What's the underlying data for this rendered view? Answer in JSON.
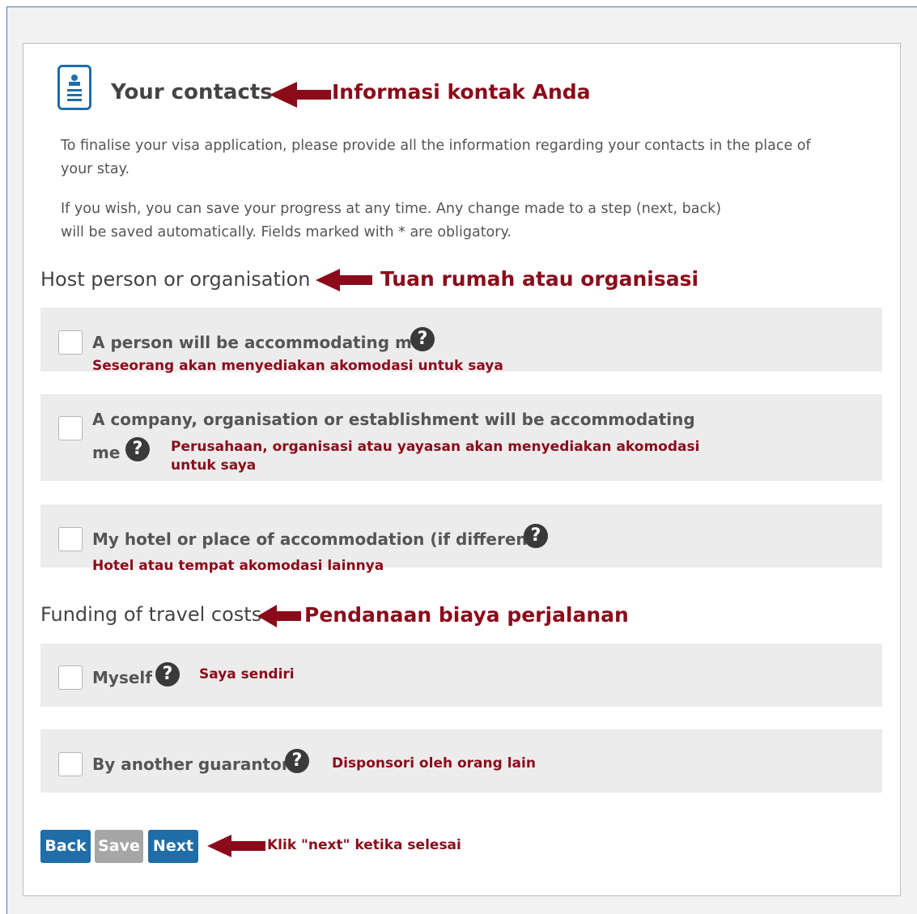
{
  "header": {
    "title": "Your contacts",
    "annotation": "Informasi kontak Anda"
  },
  "intro": {
    "line1": "To finalise your visa application, please provide all the information regarding your contacts in the place of",
    "line2": "your stay.",
    "line3": "If you wish, you can save your progress at any time. Any change made to a step (next, back)",
    "line4": "will be saved automatically. Fields marked with * are obligatory."
  },
  "host_section": {
    "heading": "Host person or organisation",
    "annotation": "Tuan rumah atau organisasi",
    "options": [
      {
        "label": "A person will be accommodating me",
        "annotation": "Seseorang akan menyediakan akomodasi untuk saya",
        "checked": false
      },
      {
        "label_line1": "A company, organisation or establishment will be accommodating",
        "label_line2": "me",
        "annotation_line1": "Perusahaan, organisasi atau yayasan akan menyediakan akomodasi",
        "annotation_line2": "untuk saya",
        "checked": false
      },
      {
        "label": "My hotel or place of accommodation (if different)",
        "annotation": "Hotel atau tempat akomodasi lainnya",
        "checked": false
      }
    ]
  },
  "funding_section": {
    "heading": "Funding of travel costs",
    "annotation": "Pendanaan biaya perjalanan",
    "options": [
      {
        "label": "Myself",
        "annotation": "Saya sendiri",
        "checked": false
      },
      {
        "label": "By another guarantor",
        "annotation": "Disponsori oleh orang lain",
        "checked": false
      }
    ]
  },
  "help_glyph": "?",
  "buttons": {
    "back": "Back",
    "save": "Save",
    "next": "Next",
    "annotation": "Klik \"next\" ketika selesai"
  },
  "colors": {
    "primary_button": "#1f6ea8",
    "disabled_button": "#a6a6a6",
    "annotation": "#8b0b1a",
    "card_bg": "#ececec"
  },
  "icons": [
    "contact-card-icon",
    "help-icon",
    "arrow-left-icon"
  ]
}
